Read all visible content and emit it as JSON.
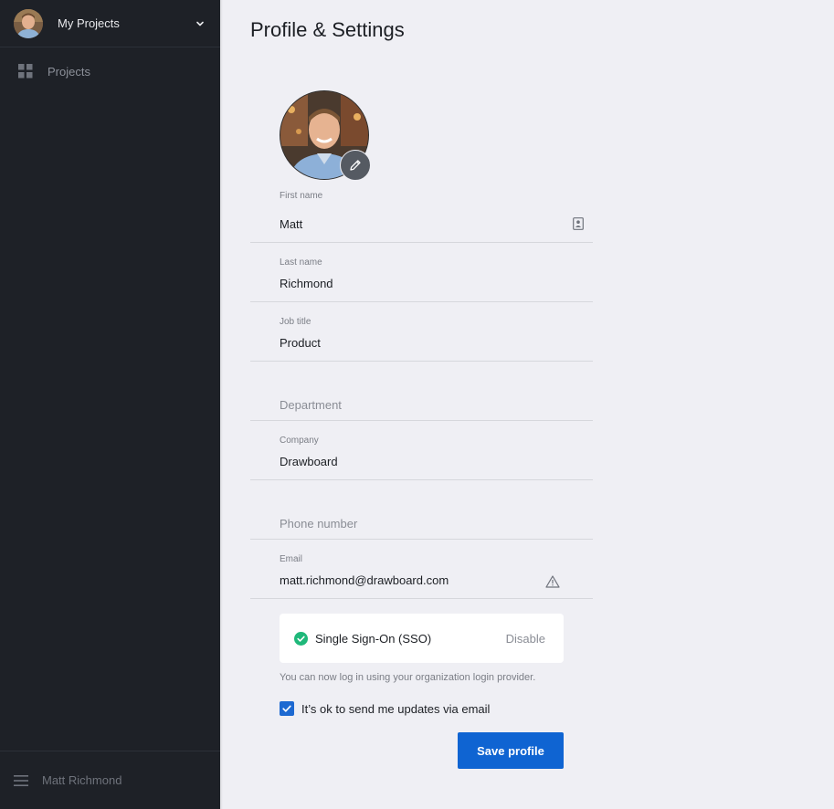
{
  "sidebar": {
    "workspace_title": "My Projects",
    "nav_items": [
      {
        "label": "Projects",
        "icon": "grid-icon"
      }
    ],
    "footer_user": "Matt Richmond"
  },
  "page": {
    "title": "Profile & Settings"
  },
  "profile": {
    "first_name": {
      "label": "First name",
      "value": "Matt"
    },
    "last_name": {
      "label": "Last name",
      "value": "Richmond"
    },
    "job_title": {
      "label": "Job title",
      "value": "Product"
    },
    "department": {
      "placeholder": "Department"
    },
    "company": {
      "label": "Company",
      "value": "Drawboard"
    },
    "phone": {
      "placeholder": "Phone number"
    },
    "email": {
      "label": "Email",
      "value": "matt.richmond@drawboard.com"
    }
  },
  "sso": {
    "label": "Single Sign-On (SSO)",
    "action": "Disable",
    "note": "You can now log in using your organization login provider.",
    "status_color": "#1fb87a"
  },
  "updates": {
    "label": "It’s ok to send me updates via email",
    "checked": true
  },
  "actions": {
    "save_label": "Save profile"
  },
  "colors": {
    "sidebar_bg": "#1e2127",
    "page_bg": "#efeff4",
    "primary": "#0f64d2"
  }
}
